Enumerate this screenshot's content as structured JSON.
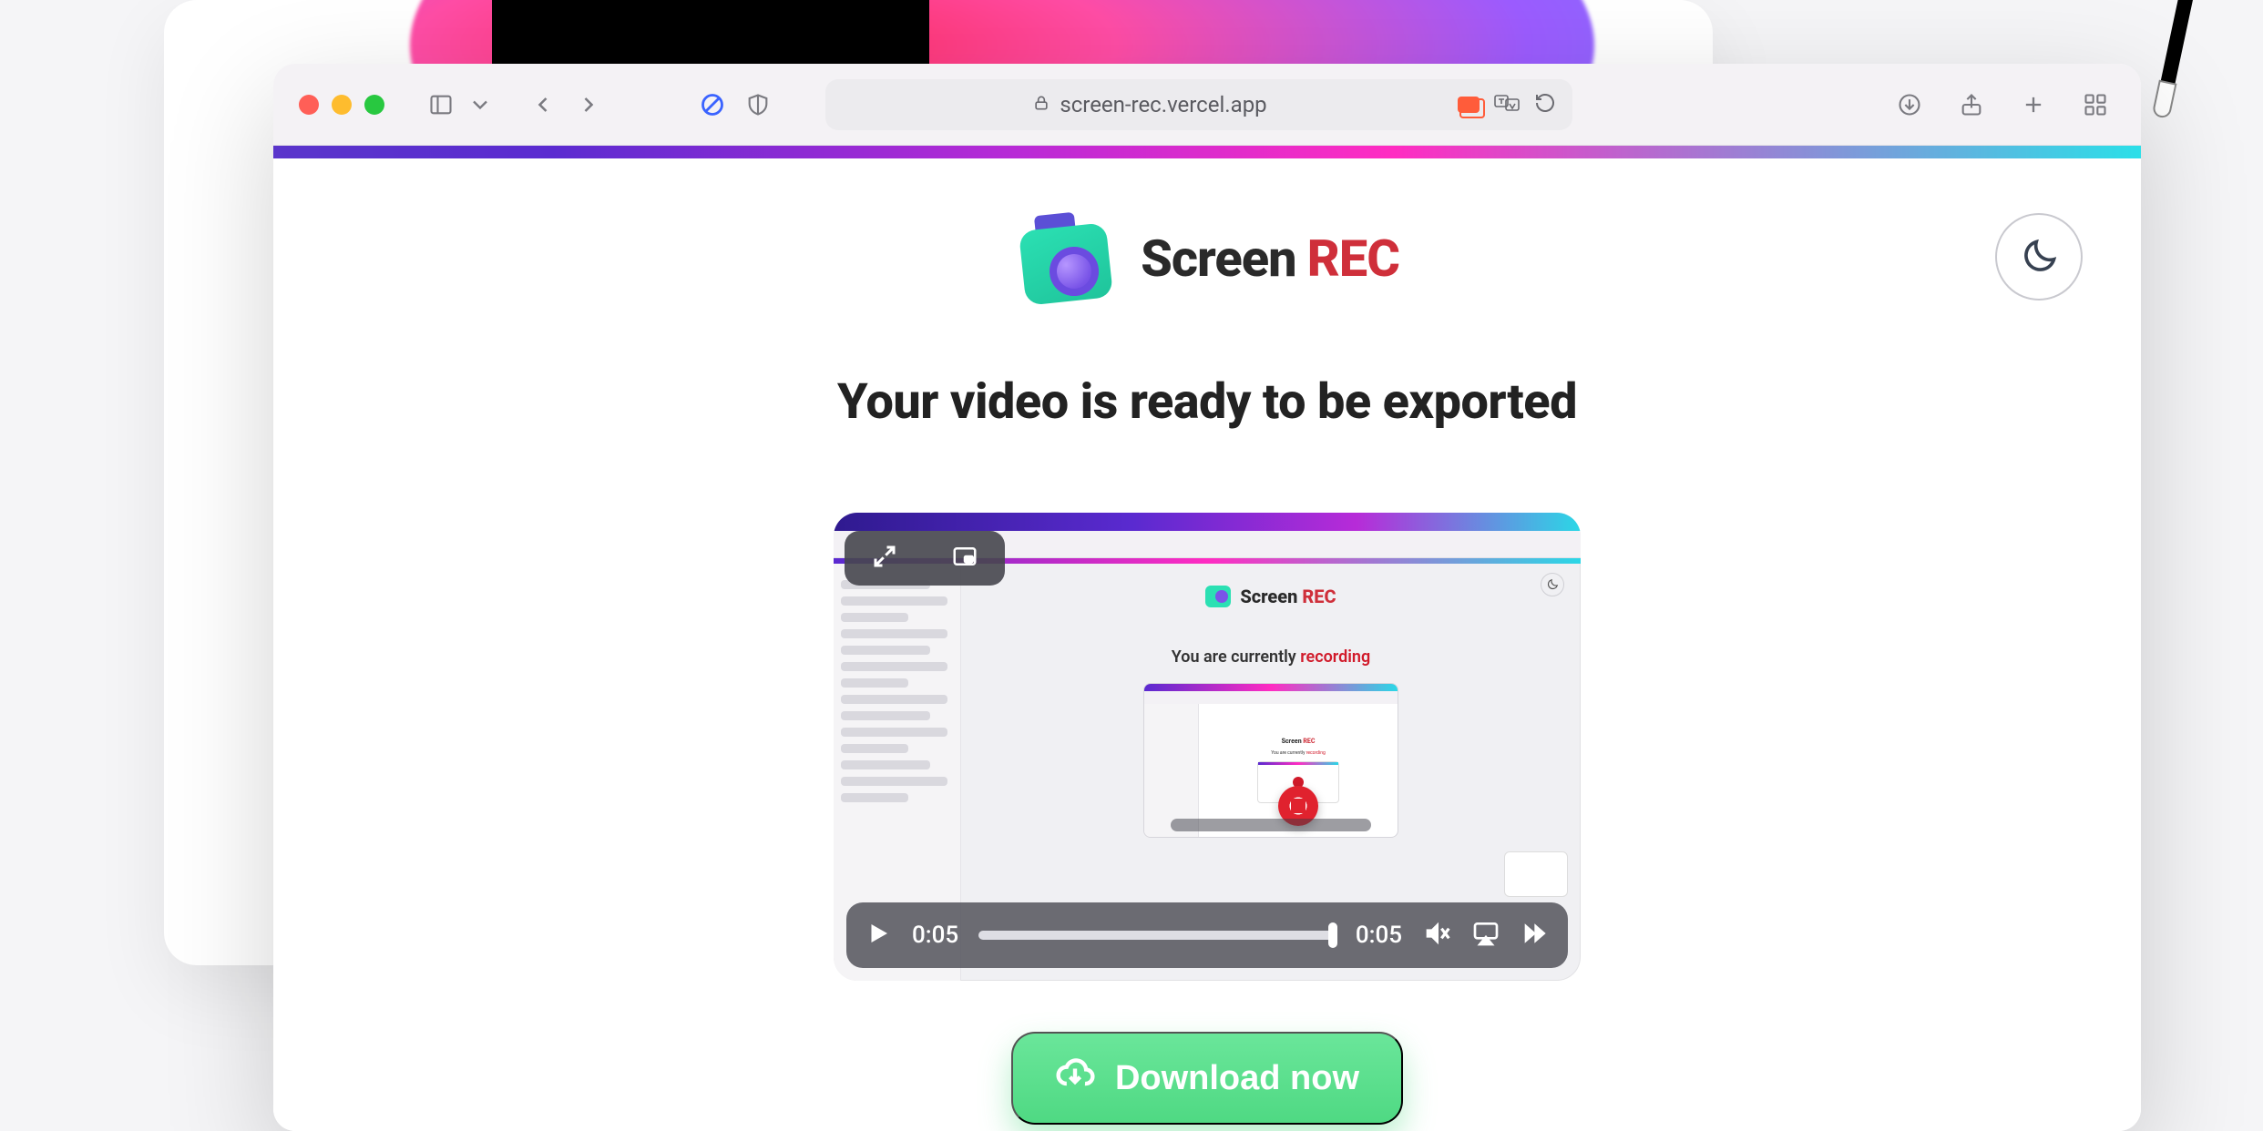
{
  "browser": {
    "url": "screen-rec.vercel.app",
    "traffic": {
      "close": "close",
      "min": "minimize",
      "max": "maximize"
    },
    "icons": {
      "sidebar": "sidebar-icon",
      "chevron_down": "chevron-down-icon",
      "back": "back-icon",
      "forward": "forward-icon",
      "block": "block-icon",
      "shield": "shield-icon",
      "lock": "lock-icon",
      "pip": "pip-icon",
      "translate": "translate-icon",
      "refresh": "refresh-icon",
      "download": "download-icon",
      "share": "share-icon",
      "add": "add-tab-icon",
      "tabs": "tabs-overview-icon"
    }
  },
  "app": {
    "brand_screen": "Screen",
    "brand_rec": "REC",
    "theme_icon": "moon-icon"
  },
  "headline": "Your video is ready to be exported",
  "preview": {
    "pip": {
      "expand": "expand-icon",
      "pip": "pip-icon"
    },
    "inner_brand_screen": "Screen",
    "inner_brand_rec": "REC",
    "inner_status_prefix": "You are currently ",
    "inner_status_word": "recording"
  },
  "player": {
    "current_time": "0:05",
    "duration": "0:05",
    "icons": {
      "play": "play-icon",
      "mute": "mute-icon",
      "airplay": "airplay-icon",
      "more": "forward-skip-icon"
    }
  },
  "download": {
    "label": "Download now",
    "icon": "cloud-download-icon"
  }
}
